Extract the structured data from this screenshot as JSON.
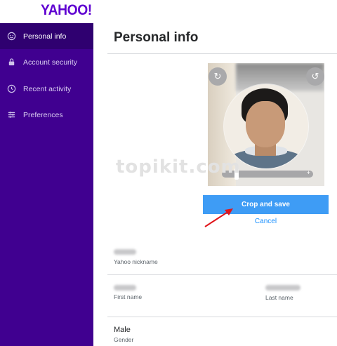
{
  "header": {
    "logo_text": "YAHOO!",
    "logo_color": "#5f01d1"
  },
  "sidebar": {
    "background": "#400090",
    "items": [
      {
        "label": "Personal info",
        "icon": "smiley-icon",
        "active": true
      },
      {
        "label": "Account security",
        "icon": "lock-icon",
        "active": false
      },
      {
        "label": "Recent activity",
        "icon": "clock-icon",
        "active": false
      },
      {
        "label": "Preferences",
        "icon": "list-settings-icon",
        "active": false
      }
    ]
  },
  "main": {
    "title": "Personal info",
    "photo_editor": {
      "rotate_left_icon": "rotate-left-icon",
      "rotate_right_icon": "rotate-right-icon",
      "zoom_plus": "+",
      "crop_save_label": "Crop and save",
      "cancel_label": "Cancel",
      "accent_color": "#3e9cf5"
    },
    "watermark": "topikit.com",
    "fields": {
      "nickname_label": "Yahoo nickname",
      "first_name_label": "First name",
      "last_name_label": "Last name",
      "gender_value": "Male",
      "gender_label": "Gender"
    }
  }
}
